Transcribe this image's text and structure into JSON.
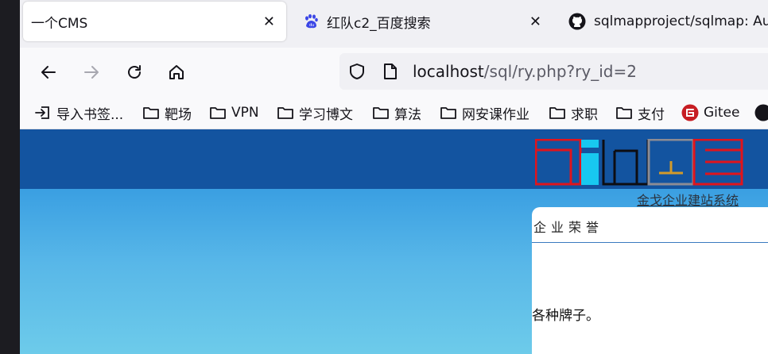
{
  "tabs": [
    {
      "title": "一个CMS",
      "active": true
    },
    {
      "title": "红队c2_百度搜索",
      "favicon": "baidu-icon"
    },
    {
      "title": "sqlmapproject/sqlmap: Au",
      "favicon": "github-icon"
    }
  ],
  "nav": {
    "url_host": "localhost",
    "url_path": "/sql/ry.php?ry_id=2"
  },
  "bookmarks": [
    {
      "label": "导入书签...",
      "icon": "import-icon"
    },
    {
      "label": "靶场",
      "icon": "folder-icon"
    },
    {
      "label": "VPN",
      "icon": "folder-icon"
    },
    {
      "label": "学习博文",
      "icon": "folder-icon"
    },
    {
      "label": "算法",
      "icon": "folder-icon"
    },
    {
      "label": "网安课作业",
      "icon": "folder-icon"
    },
    {
      "label": "求职",
      "icon": "folder-icon"
    },
    {
      "label": "支付",
      "icon": "folder-icon"
    },
    {
      "label": "Gitee",
      "icon": "gitee-icon"
    }
  ],
  "site": {
    "logo_caption": "金戈企业建站系统",
    "section_title": "企业荣誉",
    "section_body": "各种牌子。"
  },
  "colors": {
    "header_band": "#1354a0",
    "hero_top": "#3a9fe2",
    "hero_bottom": "#6dcbea",
    "logo_red": "#e0141c",
    "logo_cyan": "#18c8f0",
    "gitee_red": "#c71d23"
  }
}
